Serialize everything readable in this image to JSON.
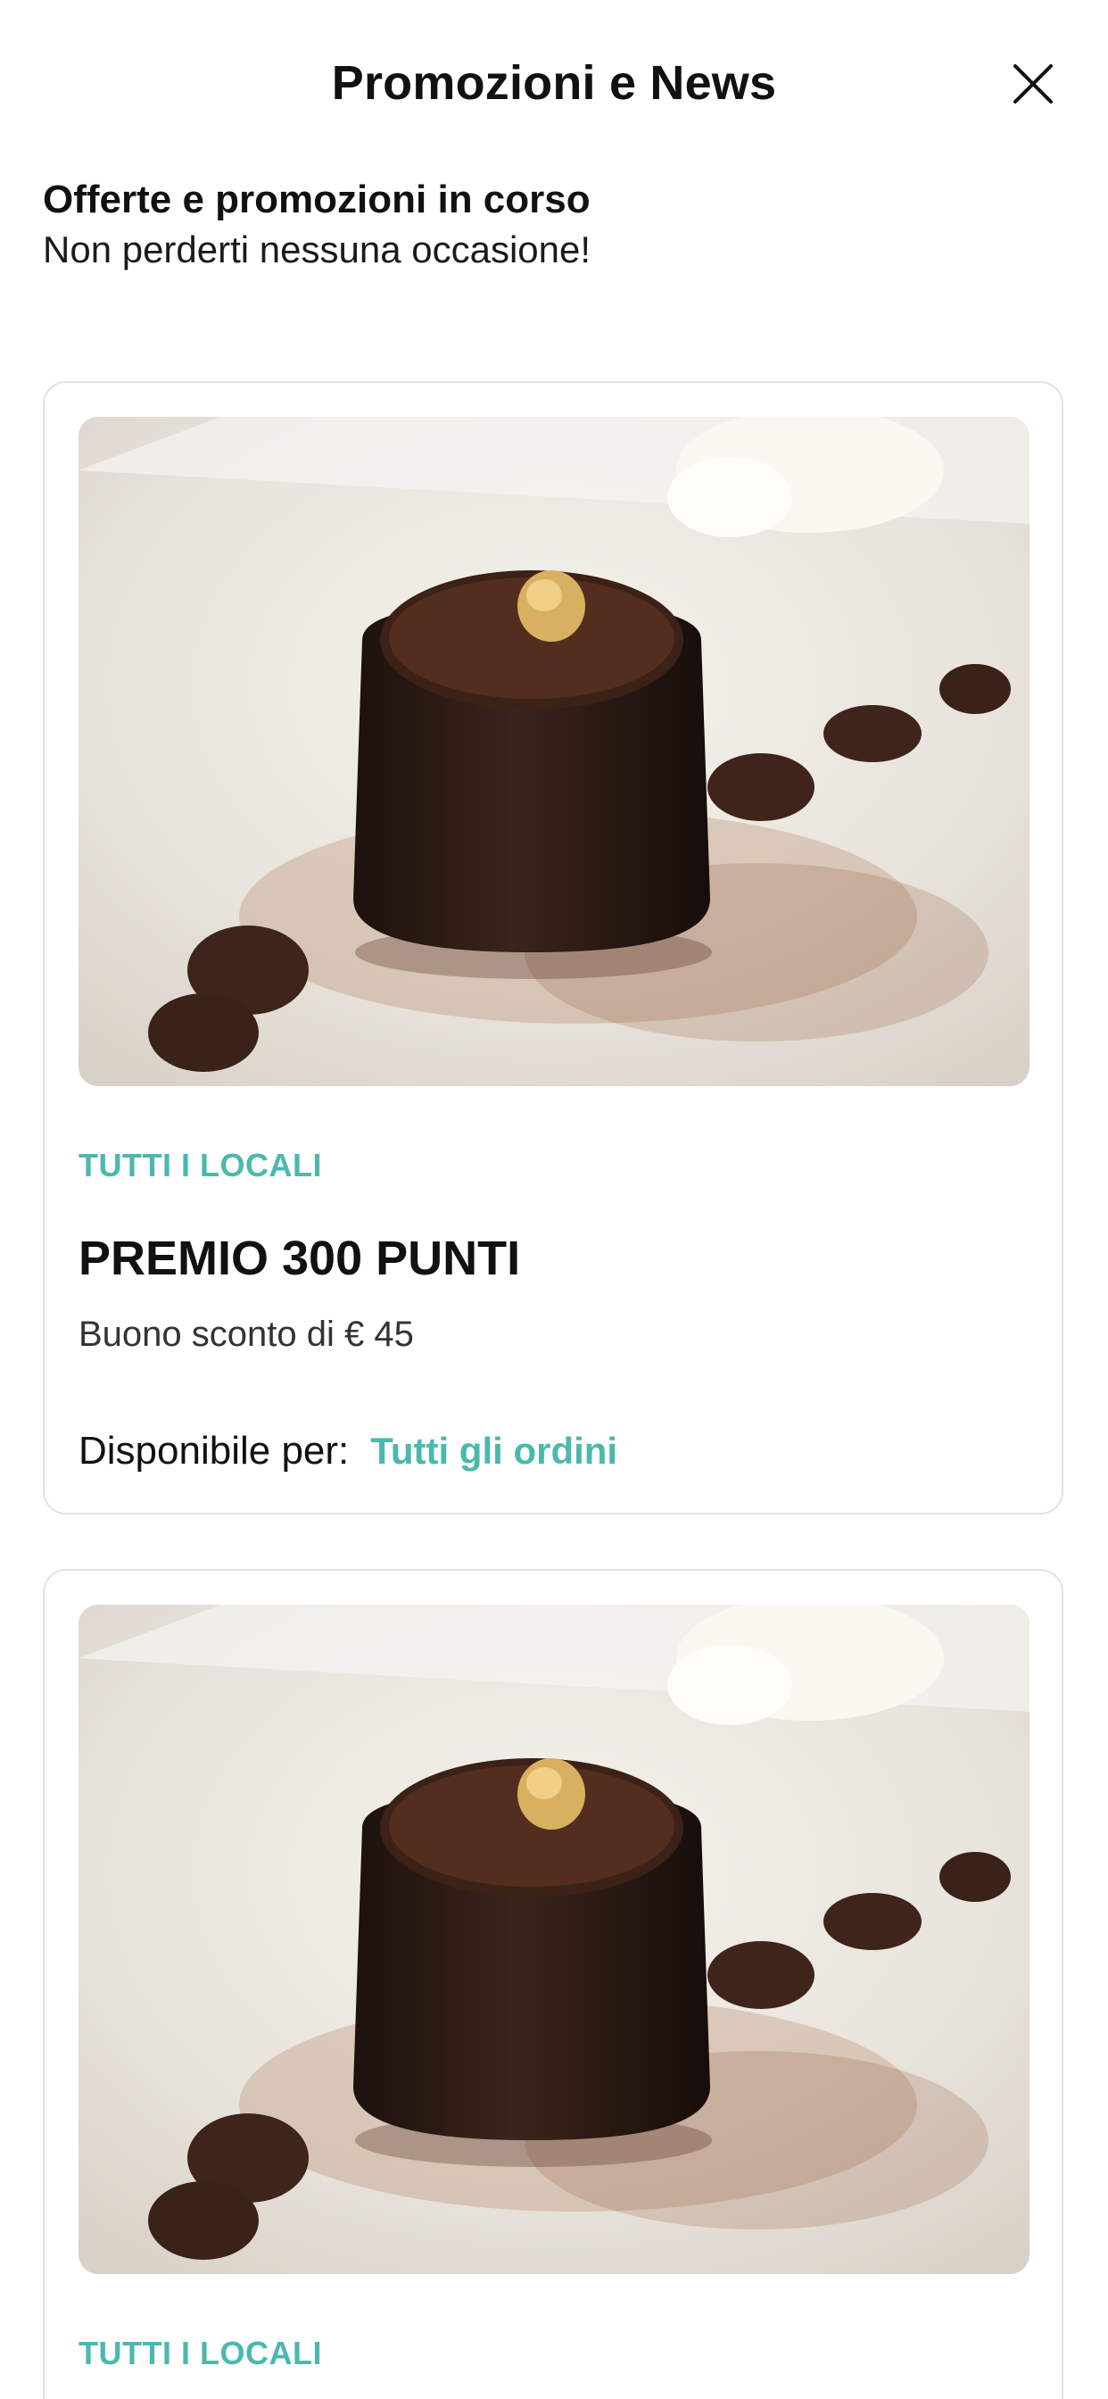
{
  "header": {
    "title": "Promozioni e News",
    "close_icon": "close-icon"
  },
  "intro": {
    "title": "Offerte e promozioni in corso",
    "subtitle": "Non perderti nessuna occasione!"
  },
  "colors": {
    "accent": "#4bb8ae",
    "text": "#111111",
    "border": "#e3e3e3"
  },
  "promotions": [
    {
      "image": "chocolate-dessert-image",
      "location": "TUTTI I LOCALI",
      "title": "PREMIO 300 PUNTI",
      "description": "Buono sconto di € 45",
      "availability_label": "Disponibile per:",
      "availability_value": "Tutti gli ordini"
    },
    {
      "image": "chocolate-dessert-image",
      "location": "TUTTI I LOCALI"
    }
  ]
}
